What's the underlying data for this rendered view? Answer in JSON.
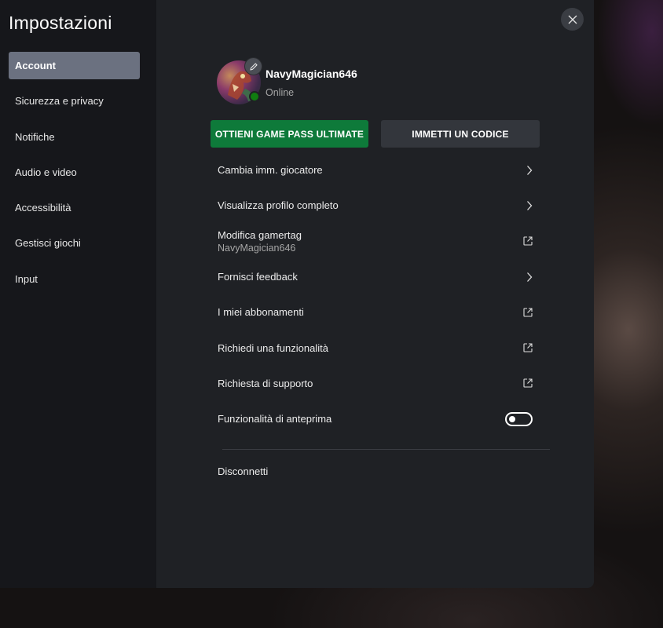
{
  "sidebar": {
    "title": "Impostazioni",
    "items": [
      {
        "label": "Account",
        "active": true
      },
      {
        "label": "Sicurezza e privacy"
      },
      {
        "label": "Notifiche"
      },
      {
        "label": "Audio e video"
      },
      {
        "label": "Accessibilità"
      },
      {
        "label": "Gestisci giochi"
      },
      {
        "label": "Input"
      }
    ]
  },
  "profile": {
    "gamertag": "NavyMagician646",
    "status": "Online",
    "edit_icon": "pencil-icon",
    "presence_color": "#107c10"
  },
  "actions": {
    "primary_label": "OTTIENI GAME PASS ULTIMATE",
    "secondary_label": "IMMETTI UN CODICE",
    "primary_color": "#0e7a3a"
  },
  "menu": [
    {
      "label": "Cambia imm. giocatore",
      "icon": "chevron-right-icon"
    },
    {
      "label": "Visualizza profilo completo",
      "icon": "chevron-right-icon"
    },
    {
      "label": "Modifica gamertag",
      "sub": "NavyMagician646",
      "icon": "external-link-icon"
    },
    {
      "label": "Fornisci feedback",
      "icon": "chevron-right-icon"
    },
    {
      "label": "I miei abbonamenti",
      "icon": "external-link-icon"
    },
    {
      "label": "Richiedi una funzionalità",
      "icon": "external-link-icon"
    },
    {
      "label": "Richiesta di supporto",
      "icon": "external-link-icon"
    },
    {
      "label": "Funzionalità di anteprima",
      "icon": "toggle",
      "toggle_on": false
    }
  ],
  "footer": {
    "disconnect_label": "Disconnetti"
  },
  "close_icon": "close-icon"
}
